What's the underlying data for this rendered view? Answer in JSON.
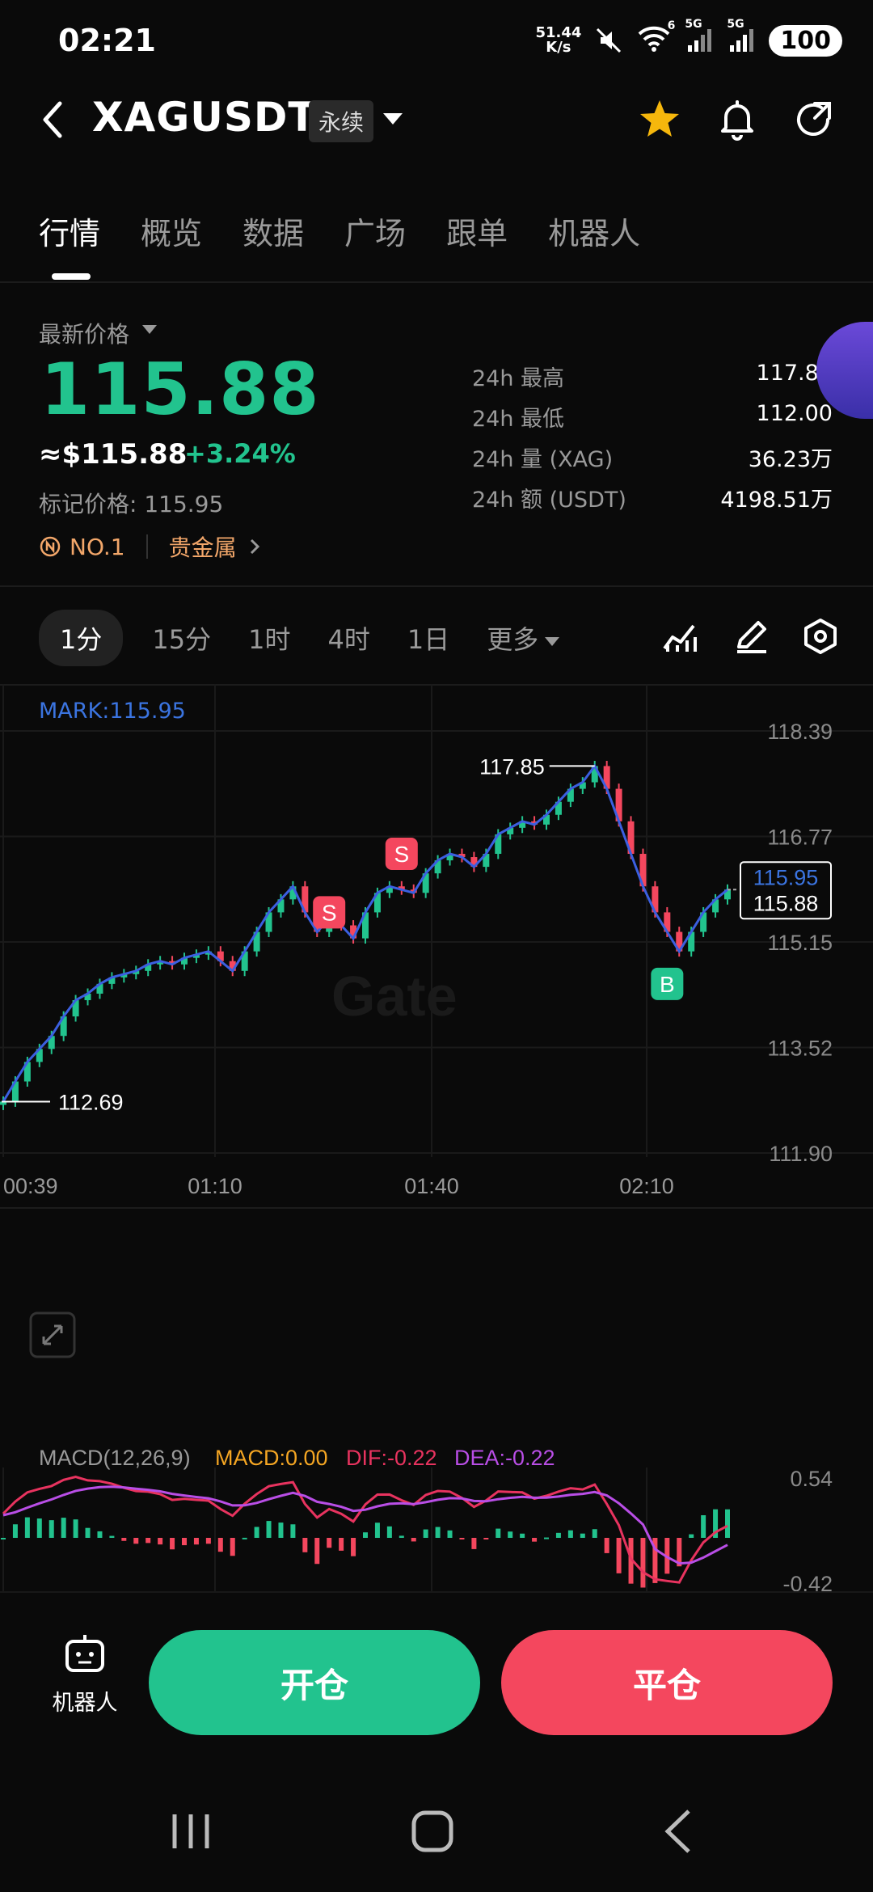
{
  "status_bar": {
    "time": "02:21",
    "net_speed_value": "51.44",
    "net_speed_unit": "K/s",
    "signal1": "5G",
    "signal2": "5G",
    "wifi_badge": "6",
    "battery": "100"
  },
  "header": {
    "symbol": "XAGUSDT",
    "contract_type": "永续"
  },
  "tabs": [
    {
      "label": "行情"
    },
    {
      "label": "概览"
    },
    {
      "label": "数据"
    },
    {
      "label": "广场"
    },
    {
      "label": "跟单"
    },
    {
      "label": "机器人"
    }
  ],
  "price": {
    "latest_label": "最新价格",
    "last": "115.88",
    "usd": "≈$115.88",
    "change": "+3.24%",
    "mark": "标记价格: 115.95",
    "rank": "NO.1",
    "category": "贵金属"
  },
  "stats": [
    {
      "k": "24h  最高",
      "v": "117.85"
    },
    {
      "k": "24h  最低",
      "v": "112.00"
    },
    {
      "k": "24h  量 (XAG)",
      "v": "36.23万"
    },
    {
      "k": "24h  额 (USDT)",
      "v": "4198.51万"
    }
  ],
  "timeframes": {
    "items": [
      "1分",
      "15分",
      "1时",
      "4时",
      "1日"
    ],
    "active": "1分",
    "more": "更多"
  },
  "colors": {
    "up": "#22c38e",
    "down": "#f4475e",
    "mark": "#3b74e0",
    "macd_label": "#f5a623",
    "dif": "#e8335f",
    "dea": "#b94ee6"
  },
  "chart_data": {
    "type": "candlestick",
    "mark_label": "MARK:115.95",
    "y_ticks": [
      "118.39",
      "116.77",
      "115.15",
      "113.52",
      "111.90"
    ],
    "x_ticks": [
      "00:39",
      "01:10",
      "01:40",
      "02:10"
    ],
    "ylim": [
      111.9,
      118.39
    ],
    "high_label": "117.85",
    "low_label": "112.69",
    "mark_tag": "115.95",
    "last_tag": "115.88",
    "close_series": [
      112.69,
      113.0,
      113.3,
      113.5,
      113.7,
      114.0,
      114.25,
      114.35,
      114.5,
      114.6,
      114.65,
      114.7,
      114.8,
      114.85,
      114.8,
      114.9,
      114.95,
      115.0,
      114.85,
      114.7,
      115.0,
      115.3,
      115.6,
      115.8,
      116.0,
      115.6,
      115.3,
      115.5,
      115.4,
      115.2,
      115.6,
      115.9,
      116.0,
      115.95,
      115.9,
      116.2,
      116.4,
      116.5,
      116.45,
      116.3,
      116.5,
      116.8,
      116.9,
      117.0,
      116.95,
      117.1,
      117.3,
      117.5,
      117.6,
      117.85,
      117.5,
      117.0,
      116.5,
      116.0,
      115.6,
      115.3,
      115.0,
      115.3,
      115.6,
      115.8,
      115.95
    ],
    "signals": [
      {
        "label": "S",
        "index": 27,
        "price": 115.6
      },
      {
        "label": "S",
        "index": 33,
        "price": 116.5
      },
      {
        "label": "B",
        "index": 55,
        "price": 114.5
      }
    ],
    "macd": {
      "label": "MACD(12,26,9)",
      "macd": "MACD:0.00",
      "dif": "DIF:-0.22",
      "dea": "DEA:-0.22",
      "y_top": "0.54",
      "y_bottom": "-0.42"
    }
  },
  "watermark": "Gate",
  "bottom": {
    "robot_label": "机器人",
    "open": "开仓",
    "close": "平仓"
  }
}
